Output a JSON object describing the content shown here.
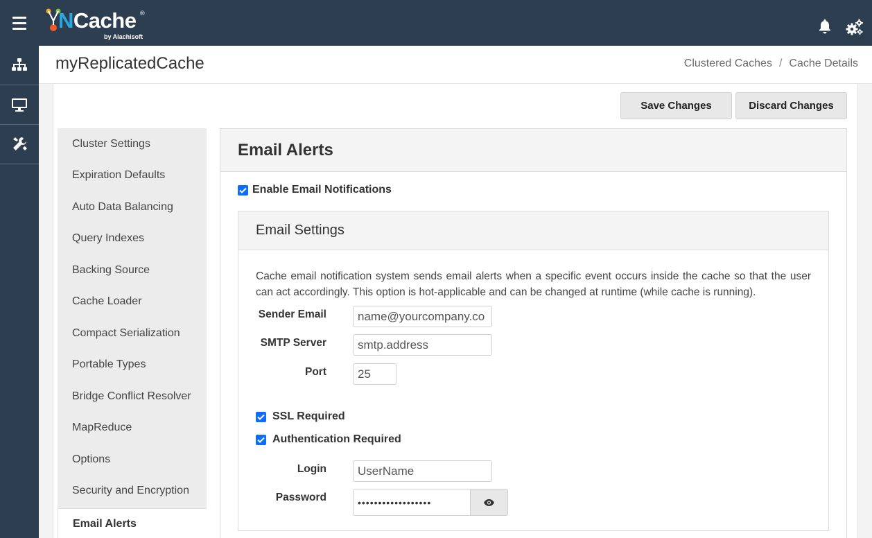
{
  "app": {
    "logo_text": "NCache",
    "logo_byline": "by Alachisoft",
    "logo_reg": "®"
  },
  "header": {
    "title": "myReplicatedCache",
    "breadcrumb": [
      "Clustered Caches",
      "Cache Details"
    ],
    "breadcrumb_sep": "/"
  },
  "toolbar": {
    "save_label": "Save Changes",
    "discard_label": "Discard Changes"
  },
  "nav": {
    "items": [
      {
        "label": "Cluster Settings"
      },
      {
        "label": "Expiration Defaults"
      },
      {
        "label": "Auto Data Balancing"
      },
      {
        "label": "Query Indexes"
      },
      {
        "label": "Backing Source"
      },
      {
        "label": "Cache Loader"
      },
      {
        "label": "Compact Serialization"
      },
      {
        "label": "Portable Types"
      },
      {
        "label": "Bridge Conflict Resolver"
      },
      {
        "label": "MapReduce"
      },
      {
        "label": "Options"
      },
      {
        "label": "Security and Encryption"
      },
      {
        "label": "Email Alerts"
      }
    ],
    "active_index": 12
  },
  "panel": {
    "title": "Email Alerts",
    "enable_label": "Enable Email Notifications",
    "enable_checked": true,
    "settings": {
      "title": "Email Settings",
      "description": "Cache email notification system sends email alerts when a specific event occurs inside the cache so that the user can act accordingly. This option is hot-applicable and can be changed at runtime (while cache is running).",
      "sender_label": "Sender Email",
      "sender_value": "name@yourcompany.co",
      "smtp_label": "SMTP Server",
      "smtp_value": "smtp.address",
      "port_label": "Port",
      "port_value": "25",
      "ssl_label": "SSL Required",
      "ssl_checked": true,
      "auth_label": "Authentication Required",
      "auth_checked": true,
      "login_label": "Login",
      "login_value": "UserName",
      "password_label": "Password",
      "password_value": "••••••••••••••••••"
    }
  },
  "colors": {
    "topbar": "#2d3e50",
    "accent": "#0d6efd",
    "logo_n": "#29a8e0"
  },
  "icons": [
    "menu-icon",
    "bell-icon",
    "gears-icon",
    "topology-icon",
    "monitor-icon",
    "tools-icon",
    "checkbox-checked-icon",
    "eye-icon"
  ]
}
